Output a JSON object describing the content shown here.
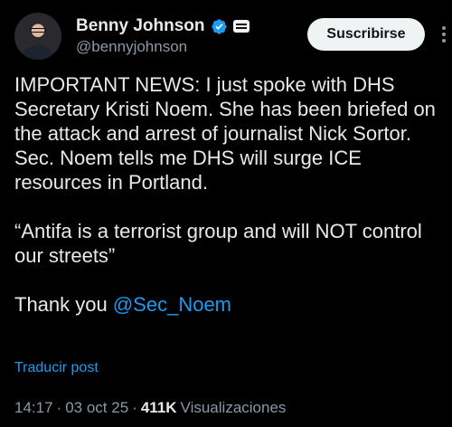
{
  "author": {
    "display_name": "Benny Johnson",
    "handle": "@bennyjohnson",
    "verified_color": "#1d9bf0"
  },
  "actions": {
    "subscribe_label": "Suscribirse"
  },
  "tweet": {
    "paragraph_1": "IMPORTANT NEWS: I just spoke with DHS Secretary Kristi Noem. She has been briefed on the attack and arrest of journalist Nick Sortor. Sec. Noem tells me DHS will surge ICE resources in Portland.",
    "paragraph_2": "“Antifa is a terrorist group and will NOT control our streets”",
    "thanks_prefix": "Thank you ",
    "mention": "@Sec_Noem"
  },
  "translate_label": "Traducir post",
  "meta": {
    "time": "14:17",
    "sep1": "·",
    "date": "03 oct 25",
    "sep2": "·",
    "views_count": "411K",
    "views_label": "Visualizaciones"
  },
  "icons": [
    "verified-badge-icon",
    "affiliate-badge-icon",
    "more-options-icon"
  ]
}
